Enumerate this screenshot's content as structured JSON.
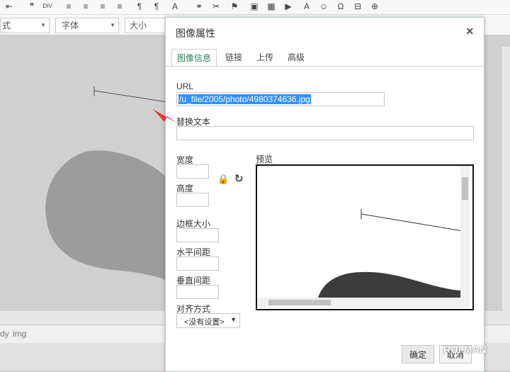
{
  "toolbar": {
    "buttons": [
      {
        "name": "outdent-icon",
        "glyph": "⇤"
      },
      {
        "name": "blockquote-icon",
        "glyph": "❞"
      },
      {
        "name": "div-icon",
        "glyph": "DIV"
      },
      {
        "name": "align-left-icon",
        "glyph": "≡"
      },
      {
        "name": "align-center-icon",
        "glyph": "≡"
      },
      {
        "name": "align-right-icon",
        "glyph": "≡"
      },
      {
        "name": "justify-icon",
        "glyph": "≡"
      },
      {
        "name": "ltr-icon",
        "glyph": "¶"
      },
      {
        "name": "rtl-icon",
        "glyph": "¶"
      },
      {
        "name": "language-icon",
        "glyph": "A"
      },
      {
        "name": "link-icon",
        "glyph": "⚭"
      },
      {
        "name": "unlink-icon",
        "glyph": "✂"
      },
      {
        "name": "anchor-icon",
        "glyph": "⚑"
      },
      {
        "name": "image-icon",
        "glyph": "▣"
      },
      {
        "name": "table-icon",
        "glyph": "▦"
      },
      {
        "name": "youtube-icon",
        "glyph": "▶"
      },
      {
        "name": "text-direction-icon",
        "glyph": "A"
      },
      {
        "name": "smiley-icon",
        "glyph": "☺"
      },
      {
        "name": "special-char-icon",
        "glyph": "Ω"
      },
      {
        "name": "page-break-icon",
        "glyph": "⊟"
      },
      {
        "name": "iframe-icon",
        "glyph": "⊕"
      }
    ],
    "style_combo": "式",
    "font_combo": "字体",
    "size_combo": "大小"
  },
  "statusbar": {
    "path1": "dy",
    "path2": "img"
  },
  "dialog": {
    "title": "图像属性",
    "close": "×",
    "tabs": [
      "图像信息",
      "链接",
      "上传",
      "高级"
    ],
    "url_label": "URL",
    "url_value": "/u_file/2005/photo/4980374636.jpg",
    "alt_label": "替换文本",
    "alt_value": "",
    "width_label": "宽度",
    "height_label": "高度",
    "border_label": "边框大小",
    "hspace_label": "水平间距",
    "vspace_label": "垂直间距",
    "align_label": "对齐方式",
    "align_value": "<没有设置>",
    "preview_label": "预览",
    "ok_label": "确定",
    "cancel_label": "取消"
  },
  "watermark": "ROI MAN",
  "colors": {
    "accent": "#2e7d5b",
    "selection": "#3390ff",
    "arrow": "#e8332a"
  }
}
